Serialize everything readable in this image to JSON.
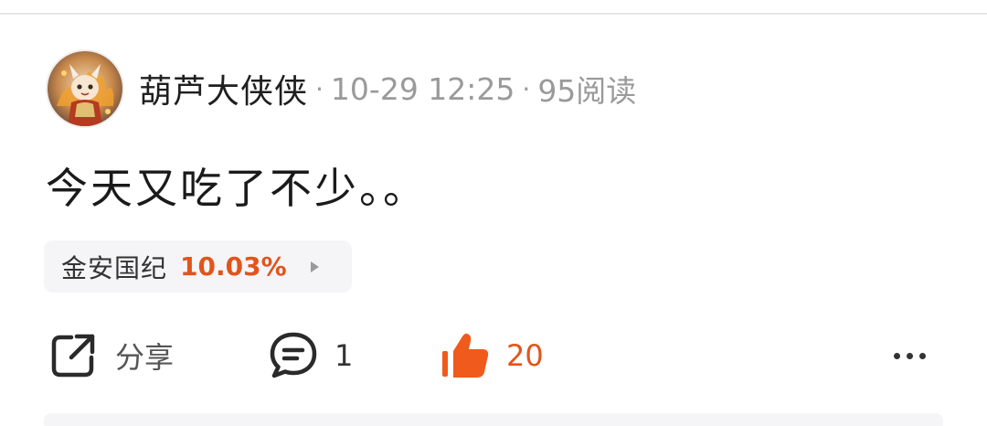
{
  "post": {
    "author": "葫芦大侠侠",
    "separator": "·",
    "time": "10-29 12:25",
    "reads": "95阅读",
    "avatar_icon": "cartoon-character-avatar",
    "content": "今天又吃了不少。。"
  },
  "stock_tag": {
    "name": "金安国纪",
    "change": "10.03%",
    "change_color": "#e2541c",
    "arrow_icon": "triangle-right-icon"
  },
  "actions": {
    "share_icon": "share-icon",
    "share_label": "分享",
    "comment_icon": "comment-bubble-icon",
    "comment_count": "1",
    "like_icon": "thumbs-up-icon",
    "like_count": "20",
    "like_color": "#f05a1c",
    "more_icon": "more-dots-icon"
  }
}
